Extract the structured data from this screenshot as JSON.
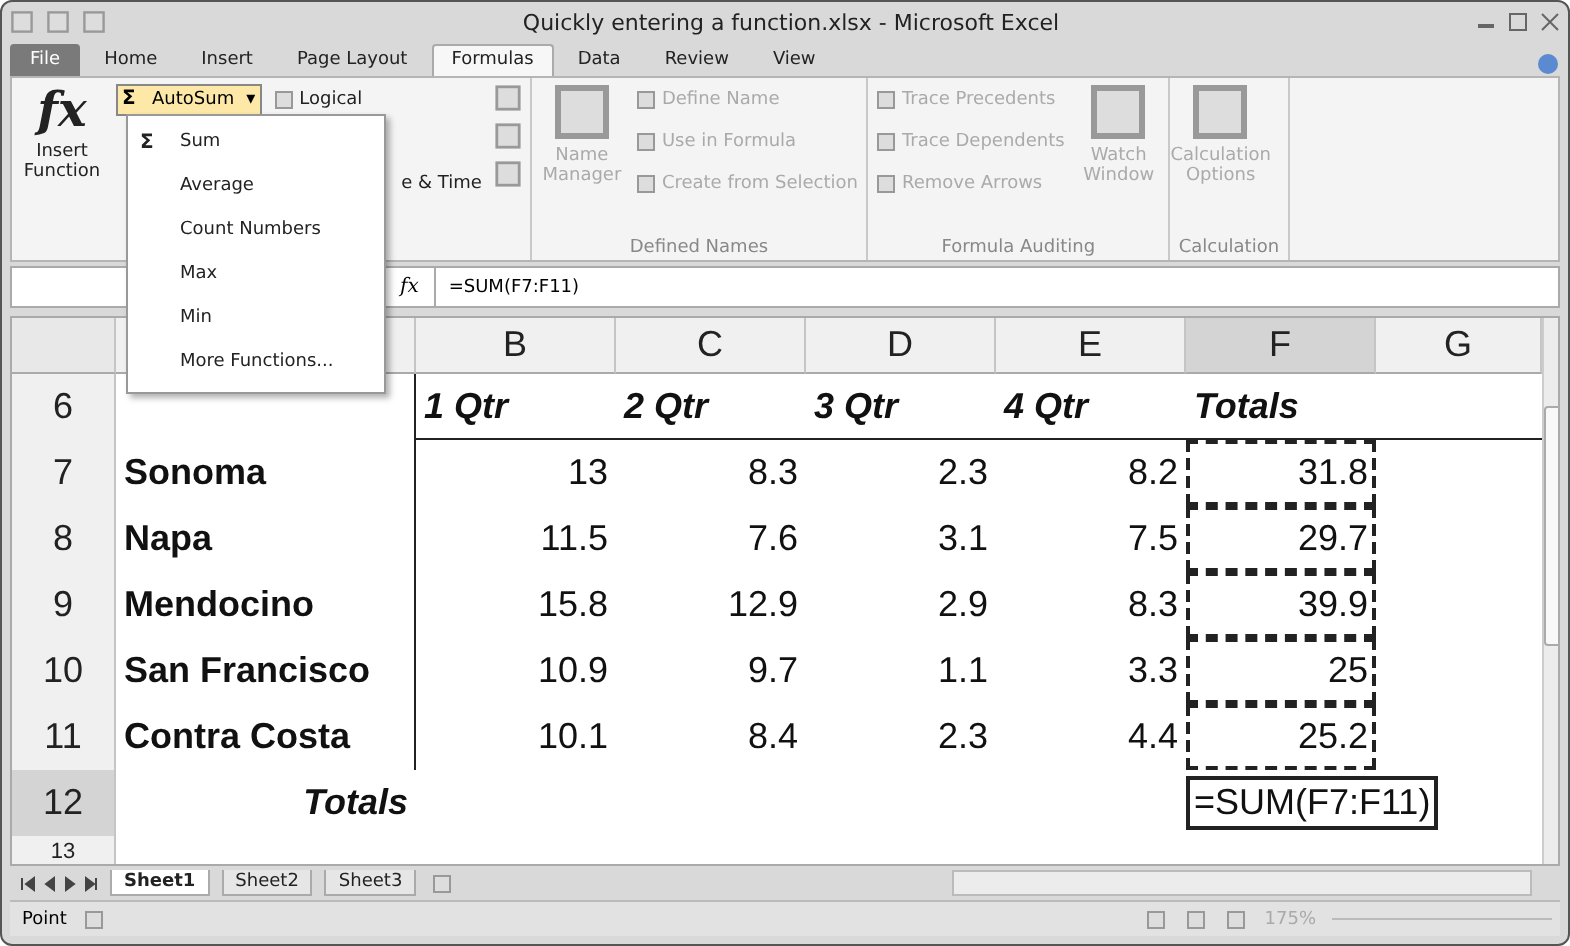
{
  "window": {
    "title": "Quickly entering a function.xlsx - Microsoft Excel"
  },
  "tabs": [
    {
      "label": "File",
      "selected": false,
      "kind": "file"
    },
    {
      "label": "Home",
      "selected": false,
      "kind": "tab"
    },
    {
      "label": "Insert",
      "selected": false,
      "kind": "tab"
    },
    {
      "label": "Page Layout",
      "selected": false,
      "kind": "tab"
    },
    {
      "label": "Formulas",
      "selected": true,
      "kind": "tab"
    },
    {
      "label": "Data",
      "selected": false,
      "kind": "tab"
    },
    {
      "label": "Review",
      "selected": false,
      "kind": "tab"
    },
    {
      "label": "View",
      "selected": false,
      "kind": "tab"
    }
  ],
  "ribbon": {
    "insert_function": {
      "glyph": "fx",
      "label": "Insert Function"
    },
    "autosum": {
      "symbol": "Σ",
      "label": "AutoSum",
      "caret": "▾",
      "expanded": true
    },
    "library": [
      {
        "label": "Logical"
      },
      {
        "label": "e & Time"
      }
    ],
    "groups": [
      {
        "label": "Defined Names",
        "items": [
          {
            "label": "Name Manager",
            "kind": "large",
            "disabled": true
          },
          {
            "label": "Define Name",
            "kind": "small",
            "disabled": true
          },
          {
            "label": "Use in Formula",
            "kind": "small",
            "disabled": true
          },
          {
            "label": "Create from Selection",
            "kind": "small",
            "disabled": true
          }
        ]
      },
      {
        "label": "Formula Auditing",
        "items": [
          {
            "label": "Trace Precedents",
            "kind": "small",
            "disabled": true
          },
          {
            "label": "Trace Dependents",
            "kind": "small",
            "disabled": true
          },
          {
            "label": "Remove Arrows",
            "kind": "small",
            "disabled": true
          },
          {
            "label": "Watch Window",
            "kind": "large",
            "disabled": true
          }
        ]
      },
      {
        "label": "Calculation",
        "items": [
          {
            "label": "Calculation Options",
            "kind": "large",
            "disabled": true
          }
        ]
      }
    ]
  },
  "autosum_menu": [
    {
      "label": "Sum",
      "kind": "sigma",
      "symbol": "Σ"
    },
    {
      "label": "Average",
      "kind": "plain"
    },
    {
      "label": "Count Numbers",
      "kind": "plain"
    },
    {
      "label": "Max",
      "kind": "plain"
    },
    {
      "label": "Min",
      "kind": "plain"
    },
    {
      "label": "More Functions...",
      "kind": "plain"
    }
  ],
  "formula_bar": {
    "fx": "fx",
    "formula": "=SUM(F7:F11)"
  },
  "columns": [
    {
      "label": "B",
      "selected": false
    },
    {
      "label": "C",
      "selected": false
    },
    {
      "label": "D",
      "selected": false
    },
    {
      "label": "E",
      "selected": false
    },
    {
      "label": "F",
      "selected": true
    },
    {
      "label": "G",
      "selected": false
    }
  ],
  "rows": [
    {
      "number": "6",
      "selected": false,
      "cells": [
        {
          "text": "",
          "kind": "label"
        },
        {
          "text": "1 Qtr",
          "kind": "heading"
        },
        {
          "text": "2 Qtr",
          "kind": "heading"
        },
        {
          "text": "3 Qtr",
          "kind": "heading"
        },
        {
          "text": "4 Qtr",
          "kind": "heading"
        },
        {
          "text": "Totals",
          "kind": "heading"
        },
        {
          "text": "",
          "kind": "value"
        }
      ]
    },
    {
      "number": "7",
      "selected": false,
      "cells": [
        {
          "text": "Sonoma",
          "kind": "label"
        },
        {
          "text": "13",
          "kind": "value"
        },
        {
          "text": "8.3",
          "kind": "value"
        },
        {
          "text": "2.3",
          "kind": "value"
        },
        {
          "text": "8.2",
          "kind": "value"
        },
        {
          "text": "31.8",
          "kind": "value",
          "marked": true
        },
        {
          "text": "",
          "kind": "value"
        }
      ]
    },
    {
      "number": "8",
      "selected": false,
      "cells": [
        {
          "text": "Napa",
          "kind": "label"
        },
        {
          "text": "11.5",
          "kind": "value"
        },
        {
          "text": "7.6",
          "kind": "value"
        },
        {
          "text": "3.1",
          "kind": "value"
        },
        {
          "text": "7.5",
          "kind": "value"
        },
        {
          "text": "29.7",
          "kind": "value",
          "marked": true
        },
        {
          "text": "",
          "kind": "value"
        }
      ]
    },
    {
      "number": "9",
      "selected": false,
      "cells": [
        {
          "text": "Mendocino",
          "kind": "label"
        },
        {
          "text": "15.8",
          "kind": "value"
        },
        {
          "text": "12.9",
          "kind": "value"
        },
        {
          "text": "2.9",
          "kind": "value"
        },
        {
          "text": "8.3",
          "kind": "value"
        },
        {
          "text": "39.9",
          "kind": "value",
          "marked": true
        },
        {
          "text": "",
          "kind": "value"
        }
      ]
    },
    {
      "number": "10",
      "selected": false,
      "cells": [
        {
          "text": "San Francisco",
          "kind": "label"
        },
        {
          "text": "10.9",
          "kind": "value"
        },
        {
          "text": "9.7",
          "kind": "value"
        },
        {
          "text": "1.1",
          "kind": "value"
        },
        {
          "text": "3.3",
          "kind": "value"
        },
        {
          "text": "25",
          "kind": "value",
          "marked": true
        },
        {
          "text": "",
          "kind": "value"
        }
      ]
    },
    {
      "number": "11",
      "selected": false,
      "cells": [
        {
          "text": "Contra Costa",
          "kind": "label"
        },
        {
          "text": "10.1",
          "kind": "value"
        },
        {
          "text": "8.4",
          "kind": "value"
        },
        {
          "text": "2.3",
          "kind": "value"
        },
        {
          "text": "4.4",
          "kind": "value"
        },
        {
          "text": "25.2",
          "kind": "value",
          "marked": true
        },
        {
          "text": "",
          "kind": "value"
        }
      ]
    },
    {
      "number": "12",
      "selected": true,
      "cells": [
        {
          "text": "Totals",
          "kind": "total"
        },
        {
          "text": "",
          "kind": "value"
        },
        {
          "text": "",
          "kind": "value"
        },
        {
          "text": "",
          "kind": "value"
        },
        {
          "text": "",
          "kind": "value"
        },
        {
          "text": "=SUM(F7:F11)",
          "kind": "editing"
        },
        {
          "text": "",
          "kind": "value"
        }
      ]
    },
    {
      "number": "13",
      "selected": false,
      "cells": []
    }
  ],
  "sheets": [
    {
      "label": "Sheet1",
      "selected": true
    },
    {
      "label": "Sheet2",
      "selected": false
    },
    {
      "label": "Sheet3",
      "selected": false
    }
  ],
  "status": {
    "mode": "Point",
    "zoom": "175%"
  }
}
